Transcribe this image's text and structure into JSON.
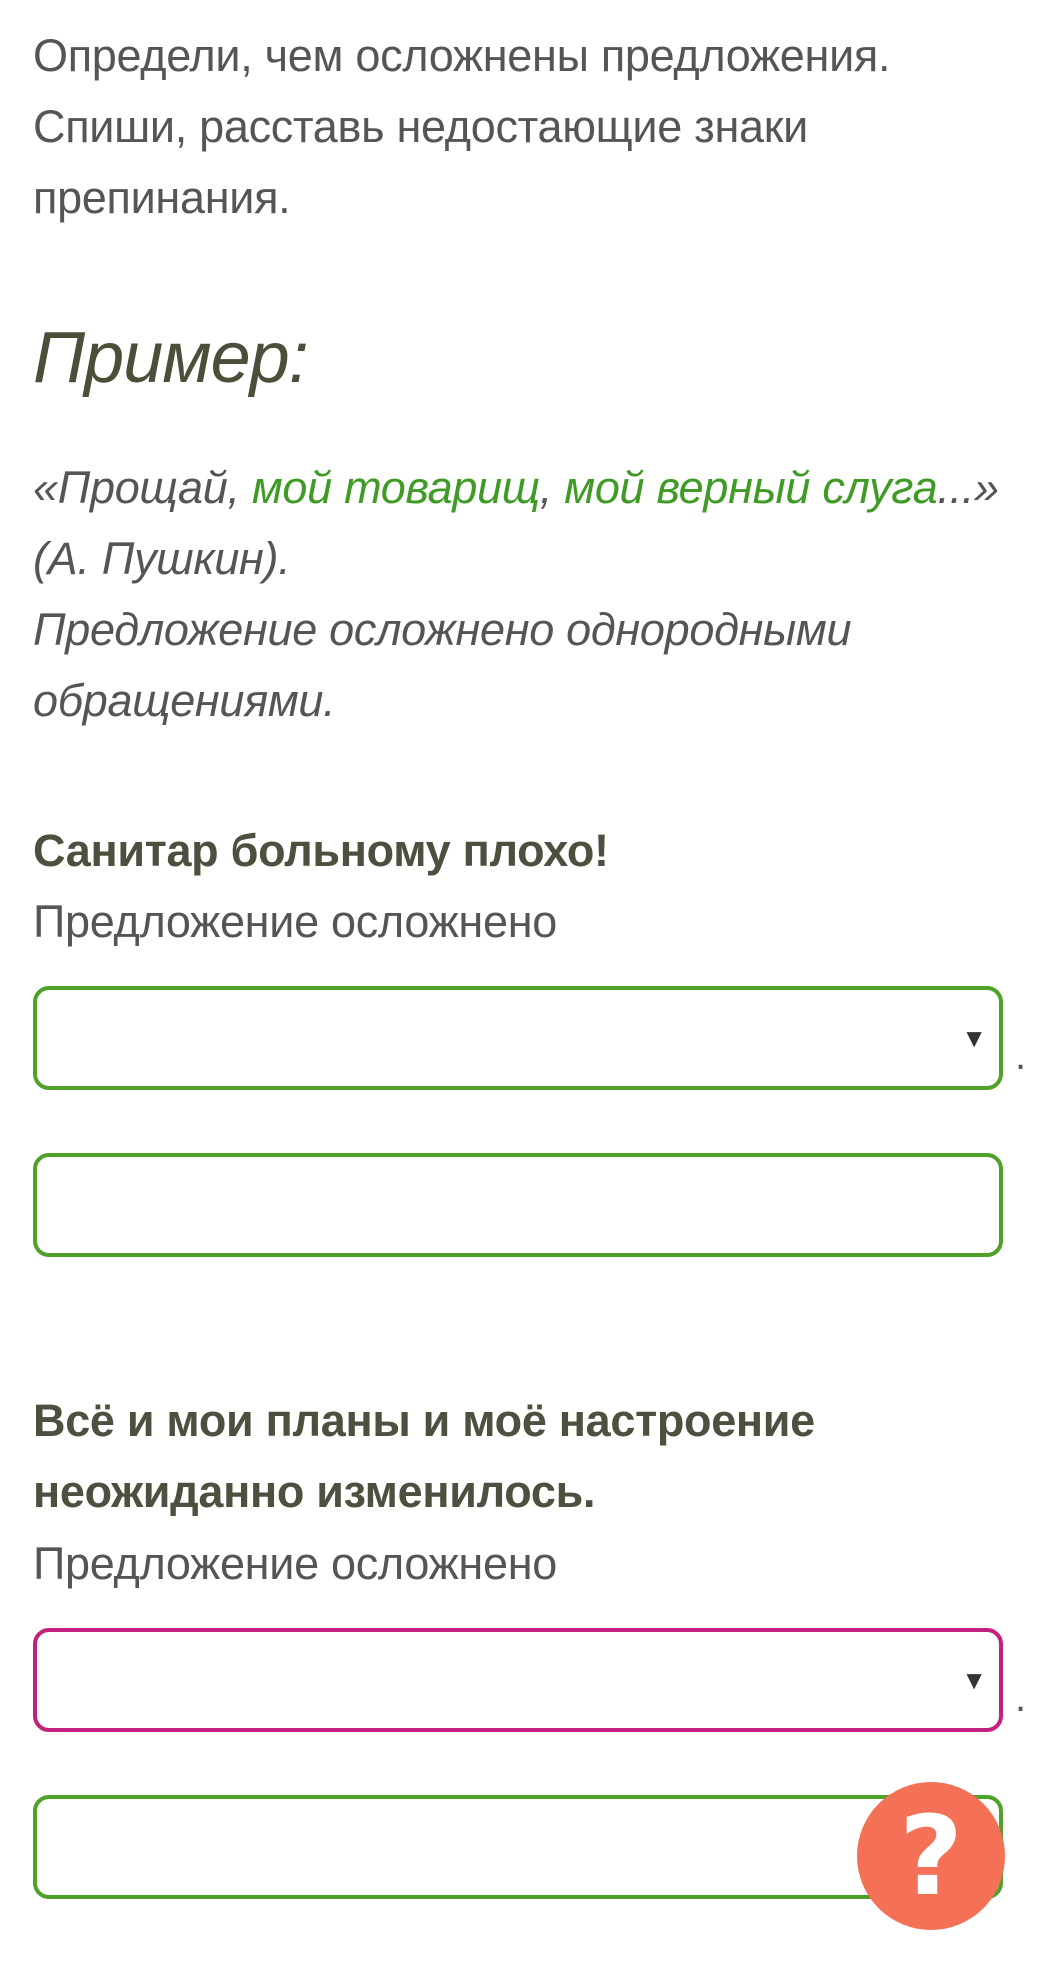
{
  "instruction": {
    "line1": "Определи, чем осложнены предложения.",
    "line2": "Спиши, расставь недостающие знаки",
    "line3": "препинания."
  },
  "example": {
    "heading": "Пример:",
    "quote_open": "«Прощай, ",
    "hl1": "мой товарищ",
    "comma": ", ",
    "hl2": "мой верный слуга",
    "quote_close": "...»",
    "author": "(А. Пушкин).",
    "explanation_line1": "Предложение осложнено однородными",
    "explanation_line2": "обращениями."
  },
  "tasks": [
    {
      "sentence_line1": "Санитар больному плохо!",
      "sentence_line2": "",
      "label": "Предложение осложнено",
      "select_value": "",
      "select_arrow": "▼",
      "period": ".",
      "input_value": ""
    },
    {
      "sentence_line1": "Всё и мои планы и моё настроение",
      "sentence_line2": "неожиданно изменилось.",
      "label": "Предложение осложнено",
      "select_value": "",
      "select_arrow": "▼",
      "period": ".",
      "input_value": ""
    }
  ],
  "help": {
    "label": "?"
  },
  "colors": {
    "accent_green": "#4fa12a",
    "highlight_green": "#3f9b25",
    "invalid_magenta": "#c3207f",
    "help_button": "#f47057"
  }
}
